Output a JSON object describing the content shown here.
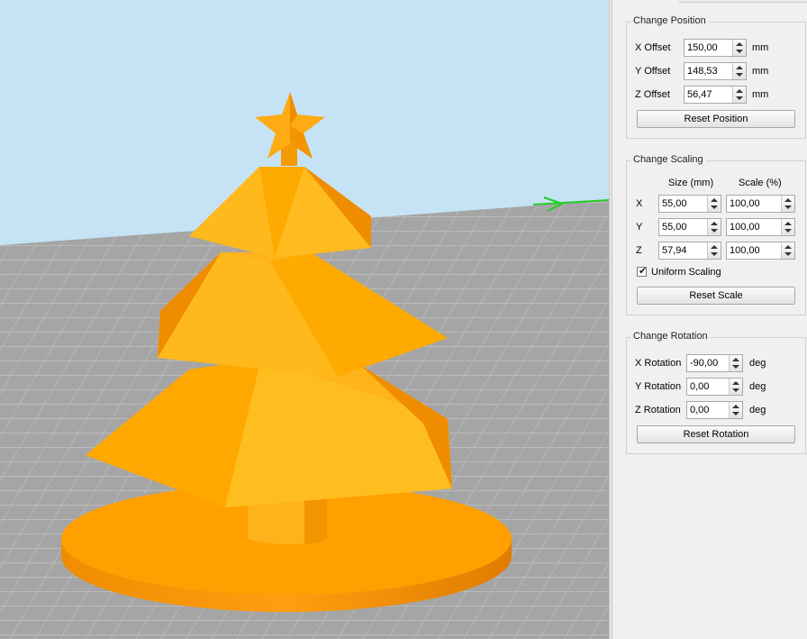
{
  "position": {
    "title": "Change Position",
    "rows": [
      {
        "label": "X Offset",
        "value": "150,00",
        "unit": "mm"
      },
      {
        "label": "Y Offset",
        "value": "148,53",
        "unit": "mm"
      },
      {
        "label": "Z Offset",
        "value": "56,47",
        "unit": "mm"
      }
    ],
    "reset_label": "Reset Position"
  },
  "scaling": {
    "title": "Change Scaling",
    "size_header": "Size (mm)",
    "scale_header": "Scale (%)",
    "rows": [
      {
        "axis": "X",
        "size": "55,00",
        "scale": "100,00"
      },
      {
        "axis": "Y",
        "size": "55,00",
        "scale": "100,00"
      },
      {
        "axis": "Z",
        "size": "57,94",
        "scale": "100,00"
      }
    ],
    "uniform_label": "Uniform Scaling",
    "uniform_checked": true,
    "reset_label": "Reset Scale"
  },
  "rotation": {
    "title": "Change Rotation",
    "rows": [
      {
        "label": "X Rotation",
        "value": "-90,00",
        "unit": "deg"
      },
      {
        "label": "Y Rotation",
        "value": "0,00",
        "unit": "deg"
      },
      {
        "label": "Z Rotation",
        "value": "0,00",
        "unit": "deg"
      }
    ],
    "reset_label": "Reset Rotation"
  },
  "colors": {
    "sky": "#c5e3f5",
    "bed": "#a5a5a5",
    "model_light": "#ffb31a",
    "model_mid": "#ffa500",
    "model_dark": "#f08c00",
    "axis_y": "#22cc22"
  }
}
